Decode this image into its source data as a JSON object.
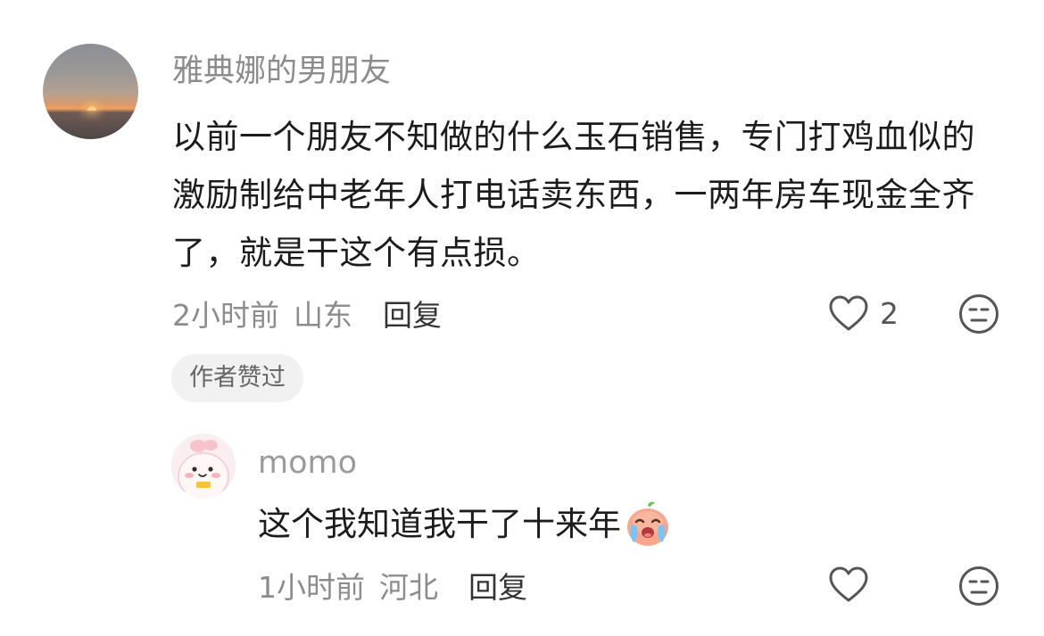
{
  "comment": {
    "username": "雅典娜的男朋友",
    "content": "以前一个朋友不知做的什么玉石销售，专门打鸡血似的激励制给中老年人打电话卖东西，一两年房车现金全齐了，就是干这个有点损。",
    "time": "2小时前",
    "location": "山东",
    "reply_label": "回复",
    "like_count": "2",
    "badge": "作者赞过"
  },
  "reply": {
    "username": "momo",
    "content": "这个我知道我干了十来年",
    "emoji": "crying-face-emoji",
    "time": "1小时前",
    "location": "河北",
    "reply_label": "回复"
  },
  "icons": {
    "like": "heart-icon",
    "dislike": "meh-face-icon"
  },
  "colors": {
    "text_primary": "#1c1c1c",
    "text_secondary": "#8c8c8c",
    "badge_background": "#f1f1f1"
  }
}
